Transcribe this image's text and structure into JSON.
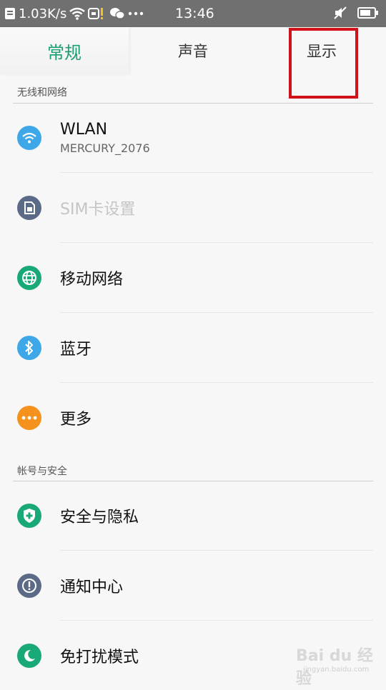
{
  "status_bar": {
    "net_speed": "1.03K/s",
    "time": "13:46",
    "icons": [
      "sim-doc-icon",
      "wifi-icon",
      "alert-icon",
      "wechat-icon",
      "more-dots-icon",
      "mute-icon",
      "battery-icon"
    ]
  },
  "tabs": [
    {
      "label": "常规",
      "active": true
    },
    {
      "label": "声音",
      "active": false
    },
    {
      "label": "显示",
      "active": false
    }
  ],
  "sections": [
    {
      "header": "无线和网络",
      "items": [
        {
          "title": "WLAN",
          "subtitle": "MERCURY_2076",
          "icon": "wifi-icon",
          "color": "#3ea7e8",
          "disabled": false
        },
        {
          "title": "SIM卡设置",
          "icon": "sim-card-icon",
          "color": "#5b6b87",
          "disabled": true
        },
        {
          "title": "移动网络",
          "icon": "globe-icon",
          "color": "#19a976",
          "disabled": false
        },
        {
          "title": "蓝牙",
          "icon": "bluetooth-icon",
          "color": "#3ea7e8",
          "disabled": false
        },
        {
          "title": "更多",
          "icon": "more-icon",
          "color": "#f5921e",
          "disabled": false
        }
      ]
    },
    {
      "header": "帐号与安全",
      "items": [
        {
          "title": "安全与隐私",
          "icon": "shield-plus-icon",
          "color": "#19a976",
          "disabled": false
        },
        {
          "title": "通知中心",
          "icon": "exclamation-icon",
          "color": "#5b6b87",
          "disabled": false
        },
        {
          "title": "免打扰模式",
          "icon": "moon-icon",
          "color": "#19a976",
          "disabled": false
        }
      ]
    }
  ],
  "watermark": {
    "text": "Bai du 经验",
    "sub": "jingyan.baidu.com"
  }
}
